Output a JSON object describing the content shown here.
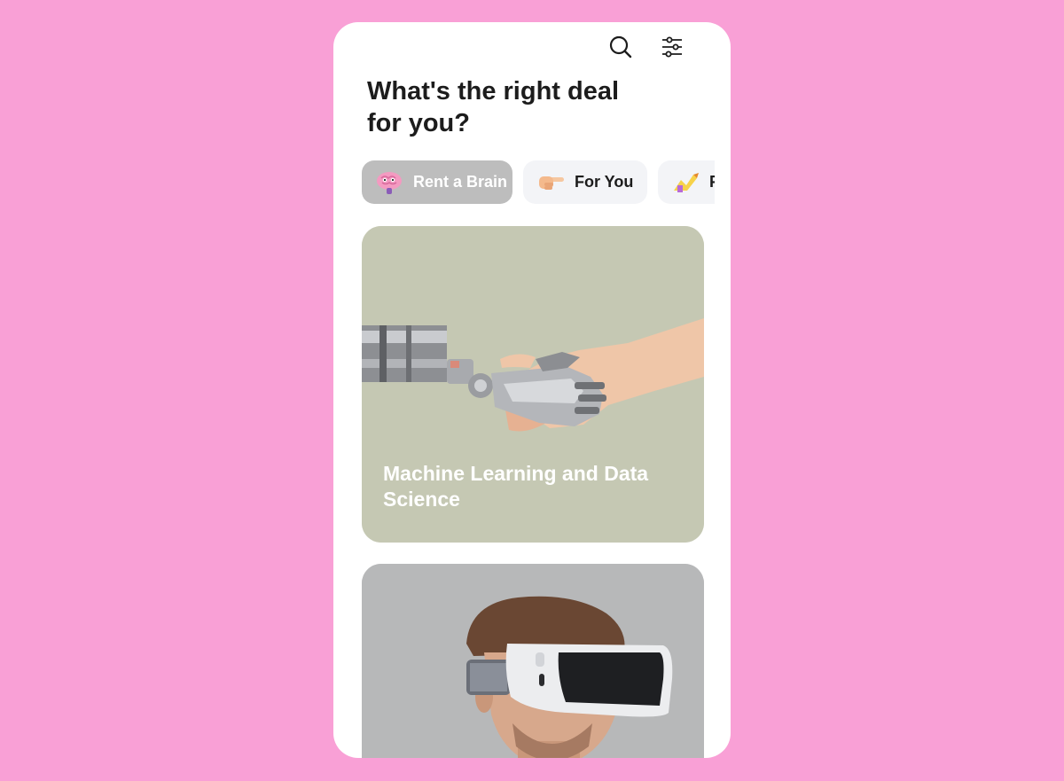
{
  "screen": {
    "background_color": "#f9a0d6",
    "headline": "What's the right deal for you?"
  },
  "topbar": {
    "search_icon": "search-icon",
    "filter_icon": "sliders-icon"
  },
  "chips": [
    {
      "label": "Rent a Brain",
      "icon": "brain-icon",
      "active": true
    },
    {
      "label": "For You",
      "icon": "pointing-hand-icon",
      "active": false
    },
    {
      "label": "F",
      "icon": "chart-icon",
      "active": false
    }
  ],
  "cards": [
    {
      "title": "Machine Learning and Data Science",
      "image": "robot-human-handshake"
    },
    {
      "title": "",
      "image": "man-wearing-vr-headset"
    }
  ],
  "colors": {
    "chip_active": "#bdbdbd",
    "chip_inactive": "#f3f4f7",
    "card_ml_bg": "#c5c8b3",
    "card_vr_bg": "#b7b8b9"
  }
}
